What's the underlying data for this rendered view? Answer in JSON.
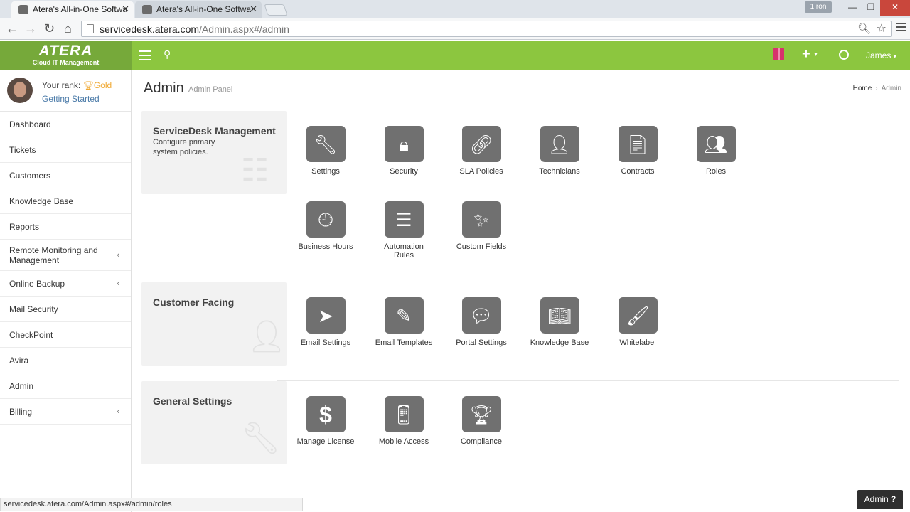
{
  "browser": {
    "tabs": [
      {
        "title": "Atera's All-in-One Softwa"
      },
      {
        "title": "Atera's All-in-One Softwa"
      }
    ],
    "user_badge": "1 ron",
    "url_host": "servicedesk.atera.com",
    "url_path": "/Admin.aspx#/admin"
  },
  "header": {
    "logo": "ATERA",
    "logo_tagline": "Cloud IT Management",
    "user": "James"
  },
  "profile": {
    "rank_label": "Your rank:",
    "rank_value": "Gold",
    "getting_started": "Getting Started"
  },
  "sidebar": {
    "items": [
      {
        "label": "Dashboard"
      },
      {
        "label": "Tickets"
      },
      {
        "label": "Customers"
      },
      {
        "label": "Knowledge Base"
      },
      {
        "label": "Reports"
      },
      {
        "label": "Remote Monitoring and Management"
      },
      {
        "label": "Online Backup"
      },
      {
        "label": "Mail Security"
      },
      {
        "label": "CheckPoint"
      },
      {
        "label": "Avira"
      },
      {
        "label": "Admin"
      },
      {
        "label": "Billing"
      }
    ]
  },
  "page": {
    "title": "Admin",
    "subtitle": "Admin Panel",
    "breadcrumb_home": "Home",
    "breadcrumb_current": "Admin"
  },
  "sections": {
    "servicedesk": {
      "title": "ServiceDesk Management",
      "description": "Configure primary system policies.",
      "tiles": [
        {
          "label": "Settings",
          "icon": "wrench-icon"
        },
        {
          "label": "Security",
          "icon": "lock-icon"
        },
        {
          "label": "SLA Policies",
          "icon": "link-icon"
        },
        {
          "label": "Technicians",
          "icon": "user-icon"
        },
        {
          "label": "Contracts",
          "icon": "document-icon"
        },
        {
          "label": "Roles",
          "icon": "users-lock-icon"
        },
        {
          "label": "Business Hours",
          "icon": "clock-icon"
        },
        {
          "label": "Automation Rules",
          "icon": "server-icon"
        },
        {
          "label": "Custom Fields",
          "icon": "magic-wand-icon"
        }
      ]
    },
    "customer_facing": {
      "title": "Customer Facing",
      "tiles": [
        {
          "label": "Email Settings",
          "icon": "paper-plane-icon"
        },
        {
          "label": "Email Templates",
          "icon": "edit-icon"
        },
        {
          "label": "Portal Settings",
          "icon": "chat-bubbles-icon"
        },
        {
          "label": "Knowledge Base",
          "icon": "book-icon"
        },
        {
          "label": "Whitelabel",
          "icon": "brush-icon"
        }
      ]
    },
    "general": {
      "title": "General Settings",
      "tiles": [
        {
          "label": "Manage License",
          "icon": "dollar-icon"
        },
        {
          "label": "Mobile Access",
          "icon": "mobile-icon"
        },
        {
          "label": "Compliance",
          "icon": "trophy-icon"
        }
      ]
    }
  },
  "status_bar": {
    "url": "servicedesk.atera.com/Admin.aspx#/admin/roles"
  },
  "footer": {
    "admin_button": "Admin"
  },
  "colors": {
    "header_green": "#8cc63f",
    "logo_green": "#76a93a",
    "tile_gray": "#707070",
    "rank_gold": "#f0a830"
  }
}
